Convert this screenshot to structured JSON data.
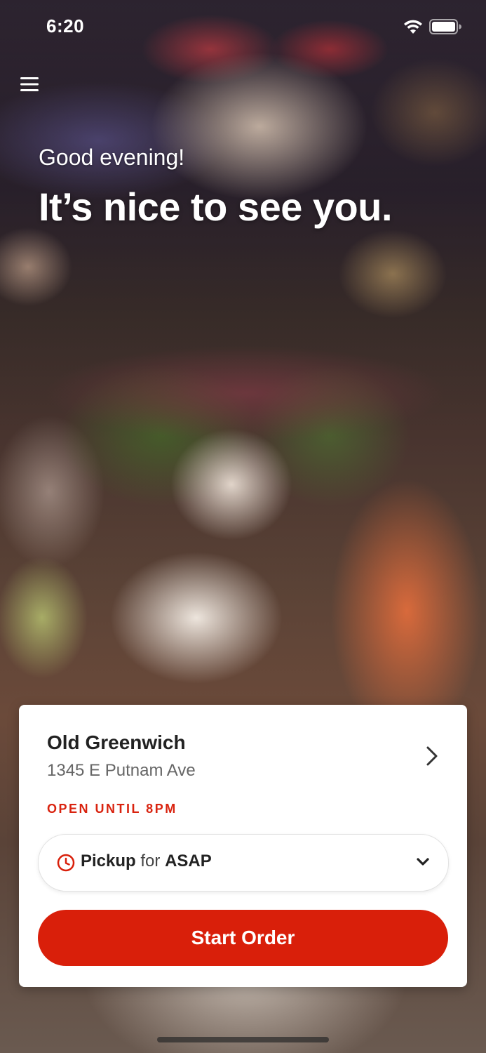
{
  "status_bar": {
    "time": "6:20",
    "wifi_icon": "wifi-icon",
    "battery_icon": "battery-icon"
  },
  "header": {
    "menu_icon": "hamburger-menu-icon",
    "greeting": "Good evening!",
    "headline": "It’s nice to see you."
  },
  "location_card": {
    "name": "Old Greenwich",
    "address": "1345 E Putnam Ave",
    "hours_status": "OPEN UNTIL 8PM",
    "chevron_icon": "chevron-right-icon",
    "order_mode": {
      "icon": "clock-icon",
      "mode": "Pickup",
      "connector": "for",
      "time": "ASAP",
      "dropdown_icon": "chevron-down-icon"
    },
    "start_order_label": "Start Order"
  },
  "colors": {
    "accent": "#d91f0a",
    "card_background": "#ffffff",
    "text_primary": "#222222",
    "text_secondary": "#666666"
  }
}
